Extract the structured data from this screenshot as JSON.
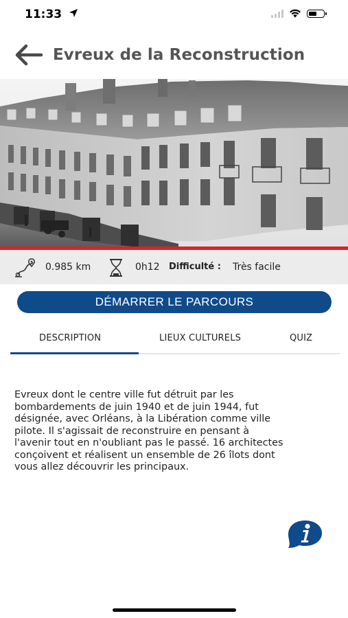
{
  "status_bar": {
    "time": "11:33"
  },
  "header": {
    "title": "Evreux de la Reconstruction"
  },
  "stats": {
    "distance": "0.985 km",
    "duration": "0h12",
    "difficulty_label": "Difficulté :",
    "difficulty_value": "Très facile"
  },
  "start_button": {
    "label": "DÉMARRER LE PARCOURS"
  },
  "tabs": [
    {
      "label": "DESCRIPTION",
      "active": true
    },
    {
      "label": "LIEUX CULTURELS",
      "active": false
    },
    {
      "label": "QUIZ",
      "active": false
    }
  ],
  "description": {
    "lines": [
      "Evreux dont le centre ville fut détruit par les",
      "bombardements de juin 1940 et de juin 1944, fut",
      "désignée, avec Orléans, à la Libération comme ville",
      "pilote. Il s'agissait de reconstruire en pensant à",
      "l'avenir tout en n'oubliant pas le passé. 16 architectes",
      "conçoivent et réalisent un ensemble de 26 îlots dont",
      "vous allez découvrir les principaux."
    ]
  },
  "colors": {
    "primary": "#0f4a8a",
    "accent_red": "#d6232a",
    "title_gray": "#555555",
    "info_bar_bg": "#ececec"
  },
  "icons": {
    "back": "arrow-left-icon",
    "distance": "route-pin-icon",
    "duration": "hourglass-icon",
    "info": "info-icon"
  }
}
